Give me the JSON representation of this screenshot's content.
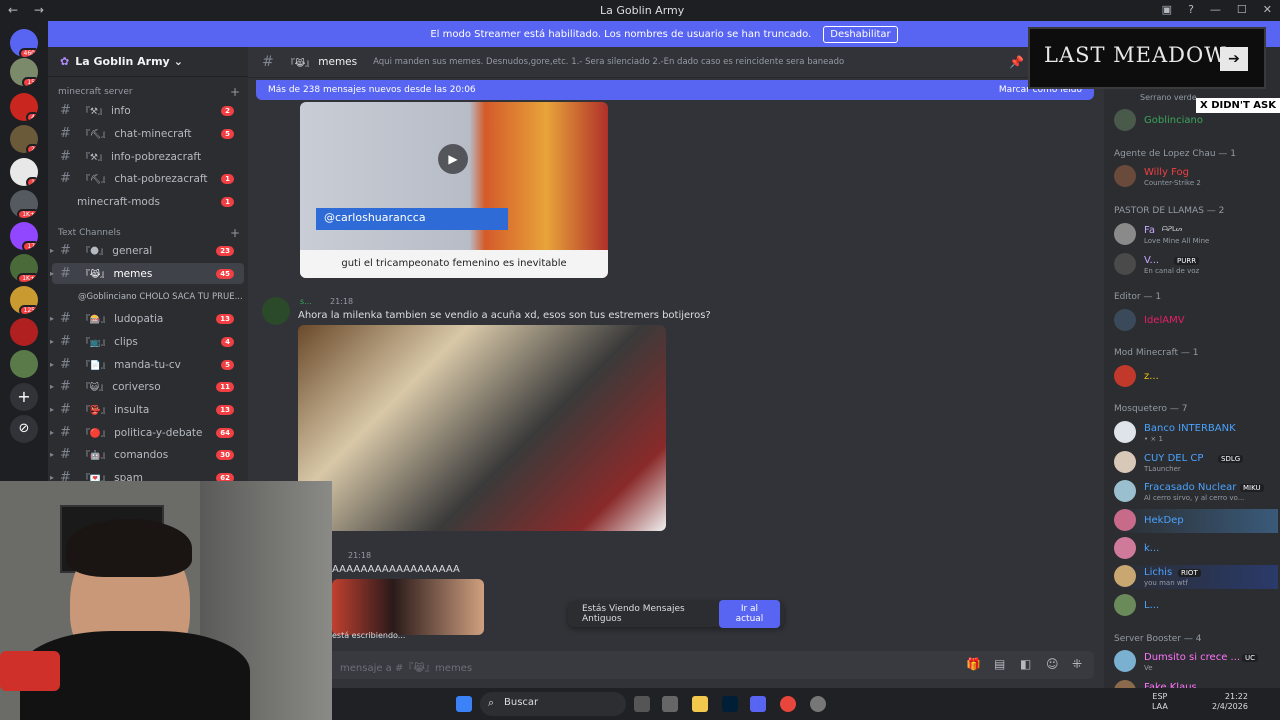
{
  "titlebar": {
    "title": "La Goblin Army"
  },
  "banner": {
    "text": "El modo Streamer está habilitado. Los nombres de usuario se han truncado.",
    "button": "Deshabilitar"
  },
  "guild_badges": [
    "460",
    "15",
    "4",
    "2",
    "1",
    "1K+",
    "17",
    "1K+",
    "125"
  ],
  "server": {
    "name": "La Goblin Army"
  },
  "categories": {
    "minecraft": "minecraft server",
    "text": "Text Channels"
  },
  "channels": [
    {
      "name": "info",
      "emoji": "『⚒』",
      "count": "2"
    },
    {
      "name": "chat-minecraft",
      "emoji": "『⛏』",
      "count": "5"
    },
    {
      "name": "info-pobrezacraft",
      "emoji": "『⚒』",
      "count": ""
    },
    {
      "name": "chat-pobrezacraft",
      "emoji": "『⛏』",
      "count": "1"
    },
    {
      "name": "minecraft-mods",
      "emoji": "",
      "count": "1"
    },
    {
      "name": "general",
      "emoji": "『🌑』",
      "count": "23"
    },
    {
      "name": "memes",
      "emoji": "『😹』",
      "count": "45"
    },
    {
      "name": "@Goblinciano CHOLO SACA TU PRUE...",
      "emoji": "",
      "count": ""
    },
    {
      "name": "ludopatia",
      "emoji": "『🎰』",
      "count": "13"
    },
    {
      "name": "clips",
      "emoji": "『📺』",
      "count": "4"
    },
    {
      "name": "manda-tu-cv",
      "emoji": "『📄』",
      "count": "5"
    },
    {
      "name": "coriverso",
      "emoji": "『😺』",
      "count": "11"
    },
    {
      "name": "insulta",
      "emoji": "『👺』",
      "count": "13"
    },
    {
      "name": "politica-y-debate",
      "emoji": "『🔴』",
      "count": "64"
    },
    {
      "name": "comandos",
      "emoji": "『🤖』",
      "count": "30"
    },
    {
      "name": "spam",
      "emoji": "『💌』",
      "count": "62"
    }
  ],
  "chat": {
    "channel_name": "memes",
    "channel_emoji": "『😹』",
    "topic": "Aqui manden sus memes. Desnudos,gore,etc. 1.- Sera silenciado 2.-En dado caso es reincidente sera baneado",
    "new_messages": "Más de 238 mensajes nuevos desde las 20:06",
    "mark_read": "Marcar como leído",
    "video_handle": "@carloshuarancca",
    "video_caption": "guti el tricampeonato femenino es inevitable",
    "msg1": {
      "user": "s...",
      "time": "21:18",
      "text": "Ahora la milenka tambien se vendio a acuña xd, esos son tus estremers botijeros?"
    },
    "msg2": {
      "time": "21:18",
      "text": "AAAAAAAAAAAAAAAAAA"
    },
    "typing": "está escribiendo...",
    "old_notice": "Estás Viendo Mensajes Antiguos",
    "jump": "Ir al actual",
    "composer_placeholder": "mensaje a #『😹』memes"
  },
  "overlay": {
    "logo": "LAST MEADOW",
    "tag": "X DIDN'T ASK"
  },
  "members": {
    "serrano": "Serrano verde",
    "goblinciano": "Goblinciano",
    "cat1": "Agente de Lopez Chau — 1",
    "willy": "Willy Fog",
    "willy_sub": "Counter-Strike 2",
    "cat2": "PASTOR DE LLAMAS — 2",
    "fa": "Fa",
    "fa_tag": "ᗩᕈᒪᔕ",
    "fa_sub": "Love Mine All Mine",
    "v": "V...",
    "v_tag": "PURR",
    "v_sub": "En canal de voz",
    "cat3": "Editor — 1",
    "idel": "IdelAMV",
    "cat4": "Mod Minecraft — 1",
    "z": "z...",
    "cat5": "Mosquetero — 7",
    "banco": "Banco INTERBANK",
    "banco_sub": "• ⨯ 1",
    "cuy": "CUY DEL CP",
    "cuy_tag": "SDLG",
    "cuy_sub": "TLauncher",
    "fracasado": "Fracasado Nuclear",
    "fracasado_tag": "MIKU",
    "fracasado_sub": "Al cerro sirvo, y al cerro vo...",
    "hekdep": "HekDep",
    "k": "k...",
    "lichis": "Lichis",
    "lichis_tag": "RIOT",
    "lichis_sub": "you man wtf",
    "l": "L...",
    "cat6": "Server Booster — 4",
    "dumsito": "Dumsito si crece ...",
    "dumsito_tag": "UC",
    "dumsito_sub": "Ve",
    "fake": "Fake Klaus"
  },
  "taskbar": {
    "search": "Buscar",
    "lang": "ESP",
    "region": "LAA",
    "time": "21:22",
    "date": "2/4/2026"
  }
}
